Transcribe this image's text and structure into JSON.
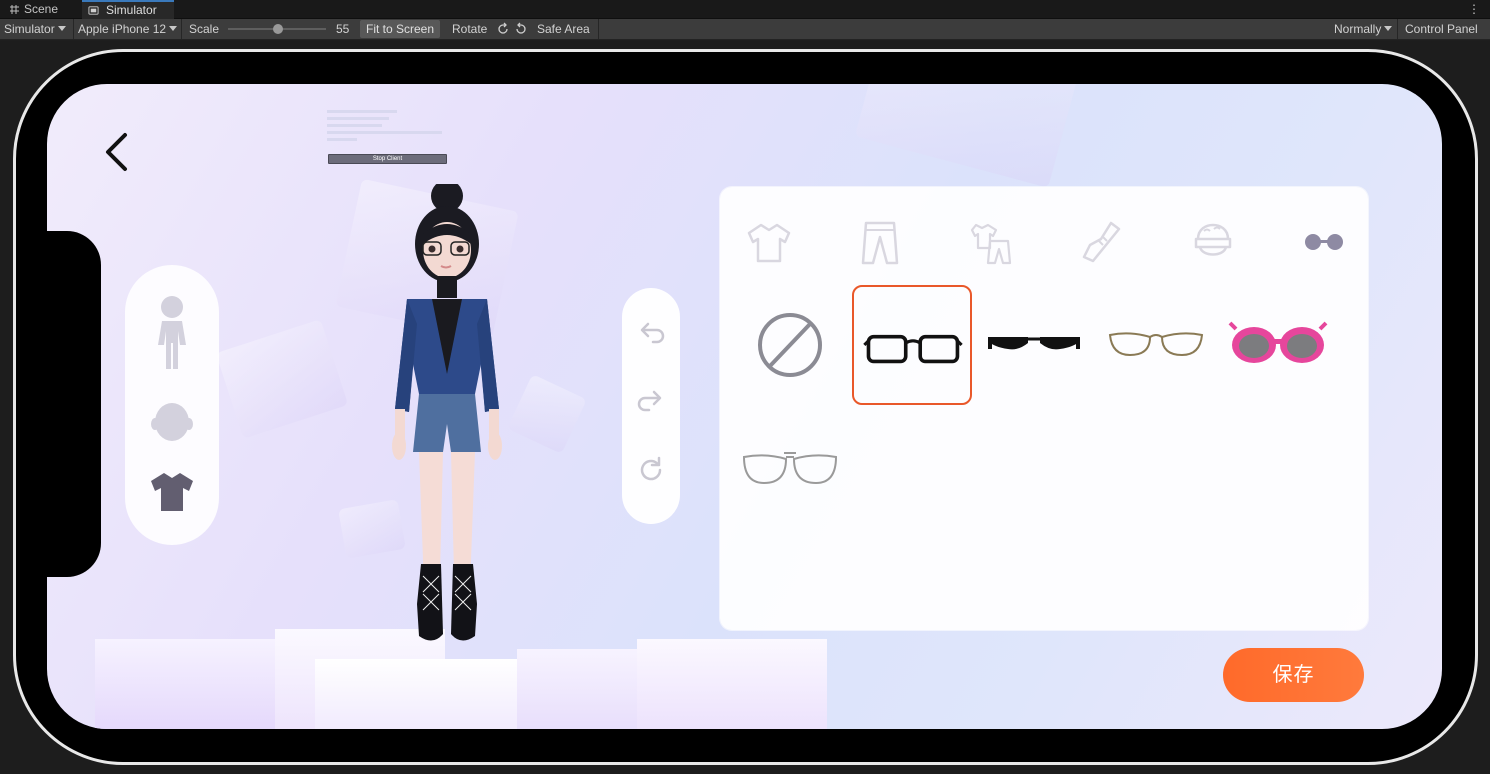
{
  "editor": {
    "tabs": [
      {
        "label": "Scene",
        "icon": "grid-icon"
      },
      {
        "label": "Simulator",
        "icon": "device-icon"
      }
    ],
    "toolbar": {
      "mode": "Simulator",
      "device": "Apple iPhone 12",
      "scale_label": "Scale",
      "scale_value": "55",
      "scale_fraction": 0.45,
      "fit_to_screen": "Fit to Screen",
      "rotate": "Rotate",
      "safe_area": "Safe Area",
      "play_mode": "Normally",
      "control_panel": "Control Panel"
    }
  },
  "app": {
    "debug_lines": [
      "Stop Client"
    ],
    "stop_client_label": "Stop Client",
    "left_nav": [
      {
        "icon": "body-icon"
      },
      {
        "icon": "head-icon"
      },
      {
        "icon": "shirt-icon",
        "active": true
      }
    ],
    "history_controls": [
      {
        "icon": "undo-icon"
      },
      {
        "icon": "redo-icon"
      },
      {
        "icon": "reset-icon"
      }
    ],
    "categories": [
      {
        "icon": "top-icon"
      },
      {
        "icon": "pants-icon"
      },
      {
        "icon": "outfit-icon"
      },
      {
        "icon": "shoe-icon"
      },
      {
        "icon": "hat-icon"
      },
      {
        "icon": "glasses-icon",
        "active": true
      }
    ],
    "items": [
      {
        "icon": "none-icon"
      },
      {
        "icon": "rectangle-glasses-icon",
        "selected": true
      },
      {
        "icon": "browline-glasses-icon"
      },
      {
        "icon": "wire-glasses-icon"
      },
      {
        "icon": "pink-sunglasses-icon"
      },
      {
        "icon": "aviator-glasses-icon"
      }
    ],
    "save_label": "保存",
    "colors": {
      "accent": "#FF6A2A",
      "selected_border": "#E9582A",
      "icon_muted": "#8E8AA3"
    }
  }
}
